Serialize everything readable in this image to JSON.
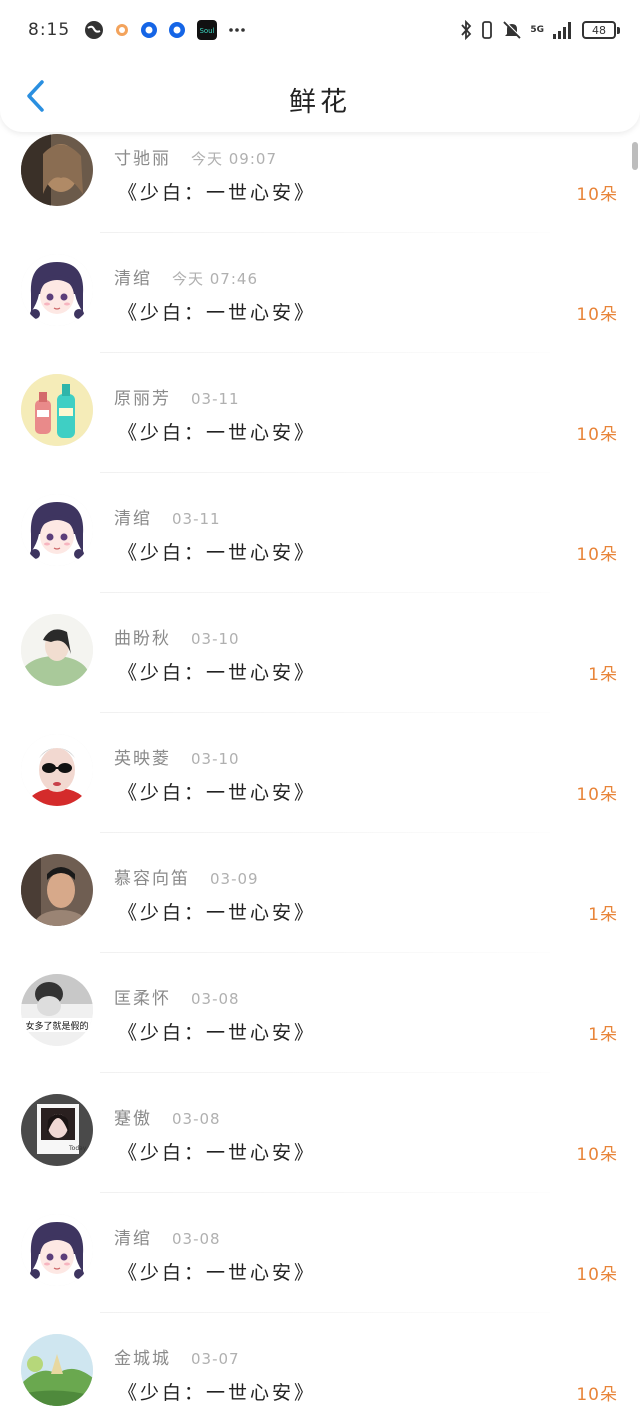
{
  "status_bar": {
    "time": "8:15",
    "network": "5G",
    "battery": "48",
    "icons": [
      "globe-icon",
      "orange-app-icon",
      "blue-app-icon-1",
      "blue-app-icon-2",
      "soul-app-icon",
      "more-dots-icon",
      "bluetooth-icon",
      "vibrate-icon",
      "mute-icon",
      "signal-icon",
      "battery-icon"
    ],
    "soul_label": "Soul"
  },
  "header": {
    "title": "鲜花",
    "back_icon": "chevron-left-icon"
  },
  "colors": {
    "accent": "#2a8fe0",
    "count": "#e8853a",
    "name": "#8a8a8a",
    "date": "#b0b0b0"
  },
  "items": [
    {
      "name": "寸驰丽",
      "date": "今天 09:07",
      "book": "《少白：一世心安》",
      "count": "10朵",
      "avatar": "photo-girl-hair"
    },
    {
      "name": "清绾",
      "date": "今天 07:46",
      "book": "《少白：一世心安》",
      "count": "10朵",
      "avatar": "anime-girl"
    },
    {
      "name": "原丽芳",
      "date": "03-11",
      "book": "《少白：一世心安》",
      "count": "10朵",
      "avatar": "bottles"
    },
    {
      "name": "清绾",
      "date": "03-11",
      "book": "《少白：一世心安》",
      "count": "10朵",
      "avatar": "anime-girl"
    },
    {
      "name": "曲盼秋",
      "date": "03-10",
      "book": "《少白：一世心安》",
      "count": "1朵",
      "avatar": "girl-green"
    },
    {
      "name": "英映菱",
      "date": "03-10",
      "book": "《少白：一世心安》",
      "count": "10朵",
      "avatar": "sunglasses-girl"
    },
    {
      "name": "慕容向笛",
      "date": "03-09",
      "book": "《少白：一世心安》",
      "count": "1朵",
      "avatar": "man-photo"
    },
    {
      "name": "匡柔怀",
      "date": "03-08",
      "book": "《少白：一世心安》",
      "count": "1朵",
      "avatar": "bw-text",
      "avatar_text": "女多了就是假的"
    },
    {
      "name": "蹇傲",
      "date": "03-08",
      "book": "《少白：一世心安》",
      "count": "10朵",
      "avatar": "polaroid-girl"
    },
    {
      "name": "清绾",
      "date": "03-08",
      "book": "《少白：一世心安》",
      "count": "10朵",
      "avatar": "anime-girl"
    },
    {
      "name": "金城城",
      "date": "03-07",
      "book": "《少白：一世心安》",
      "count": "10朵",
      "avatar": "landscape"
    }
  ]
}
